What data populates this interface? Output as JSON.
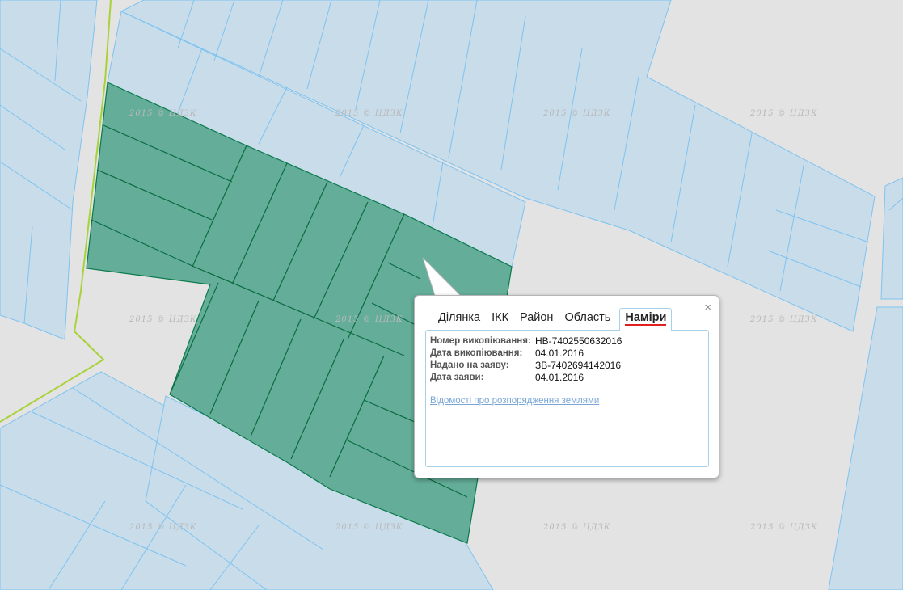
{
  "watermark_text": "2015 © ЦДЗК",
  "colors": {
    "map_background": "#e3e3e3",
    "parcel_fill": "#c9dcea",
    "parcel_stroke": "#7ec3f0",
    "selected_fill": "#64ae99",
    "selected_stroke": "#0b7a4c",
    "boundary": "#a9d23a",
    "annotation_red": "#e02020"
  },
  "popup": {
    "close_label": "×",
    "tabs": [
      {
        "label": "Ділянка"
      },
      {
        "label": "ІКК"
      },
      {
        "label": "Район"
      },
      {
        "label": "Область"
      },
      {
        "label": "Наміри",
        "active": true
      }
    ],
    "rows": [
      {
        "key": "Номер викопіювання:",
        "value": "НВ-7402550632016"
      },
      {
        "key": "Дата викопіювання:",
        "value": "04.01.2016"
      },
      {
        "key": "Надано на заяву:",
        "value": "ЗВ-7402694142016"
      },
      {
        "key": "Дата заяви:",
        "value": "04.01.2016"
      }
    ],
    "link": "Відомості про розпорядження землями"
  }
}
